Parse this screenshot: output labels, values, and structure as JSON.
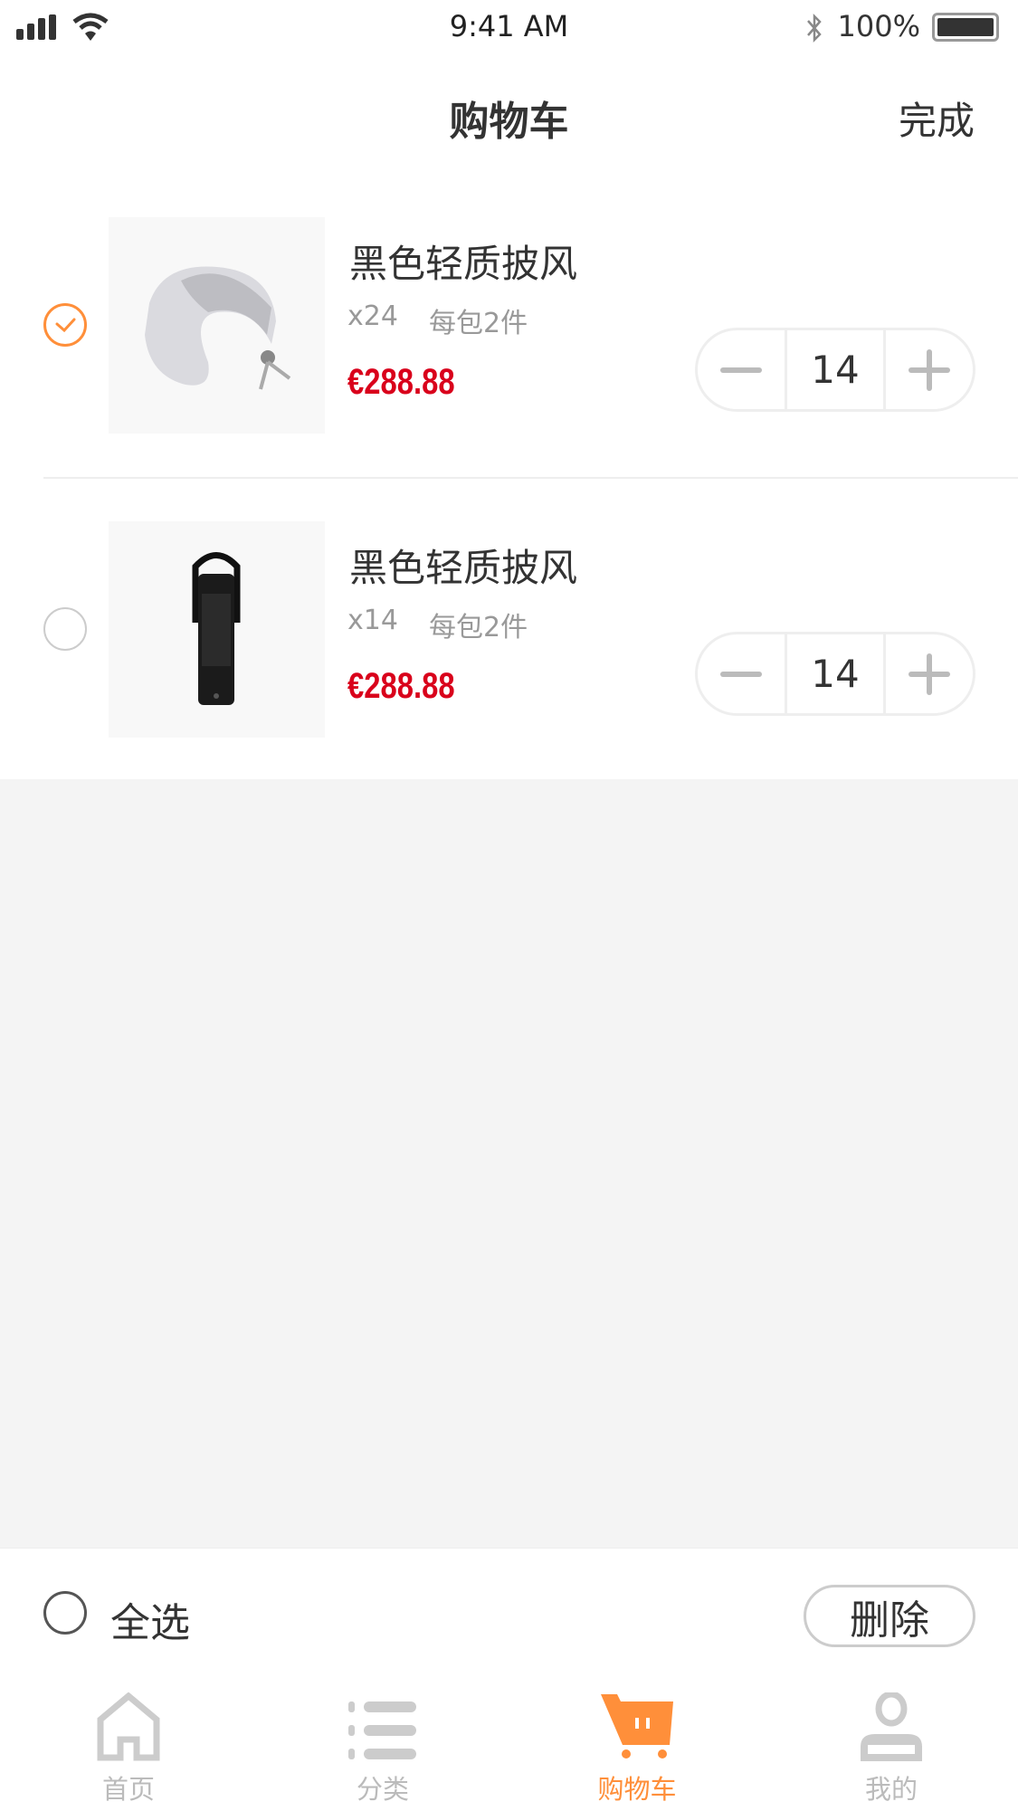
{
  "status_bar": {
    "time": "9:41 AM",
    "battery": "100%"
  },
  "header": {
    "title": "购物车",
    "done_label": "完成"
  },
  "items": [
    {
      "title": "黑色轻质披风",
      "qty": "x24",
      "pack": "每包2件",
      "price": "€288.88",
      "count": "14",
      "selected": true,
      "image": "neck-pillow"
    },
    {
      "title": "黑色轻质披风",
      "qty": "x14",
      "pack": "每包2件",
      "price": "€288.88",
      "count": "14",
      "selected": false,
      "image": "black-portable-kettle"
    }
  ],
  "footer": {
    "select_all": "全选",
    "delete_label": "删除"
  },
  "tabs": [
    {
      "label": "首页",
      "icon": "home-icon"
    },
    {
      "label": "分类",
      "icon": "list-icon"
    },
    {
      "label": "购物车",
      "icon": "cart-icon",
      "active": true
    },
    {
      "label": "我的",
      "icon": "user-icon"
    }
  ],
  "colors": {
    "accent": "#ff8f3a",
    "price": "#d9001b",
    "background": "#f4f4f4"
  }
}
